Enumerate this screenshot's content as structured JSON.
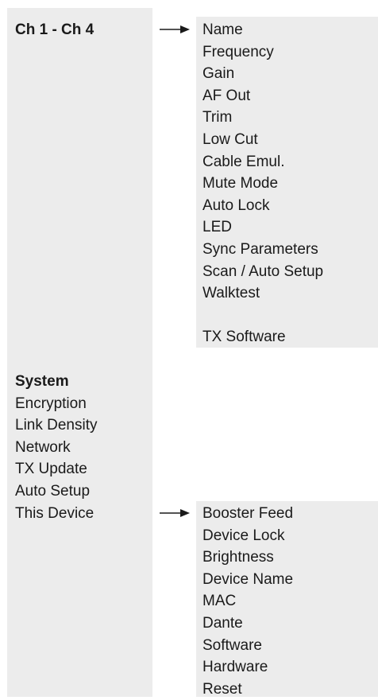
{
  "channel_section": {
    "heading": "Ch 1 - Ch 4",
    "items": [
      "Name",
      "Frequency",
      "Gain",
      "AF Out",
      "Trim",
      "Low Cut",
      "Cable Emul.",
      "Mute Mode",
      "Auto Lock",
      "LED",
      "Sync Parameters",
      "Scan / Auto Setup",
      "Walktest",
      "",
      "TX Software"
    ]
  },
  "system_section": {
    "heading": "System",
    "items": [
      "Encryption",
      "Link Density",
      "Network",
      "TX Update",
      "Auto Setup",
      "This Device"
    ],
    "submenu_items": [
      "Booster Feed",
      "Device Lock",
      "Brightness",
      "Device Name",
      "MAC",
      "Dante",
      "Software",
      "Hardware",
      "Reset"
    ]
  },
  "colors": {
    "panel_background": "#ececec",
    "text": "#1a1a1a",
    "arrow": "#1a1a1a"
  },
  "icons": {
    "submenu_arrow": "right-arrow-icon"
  }
}
